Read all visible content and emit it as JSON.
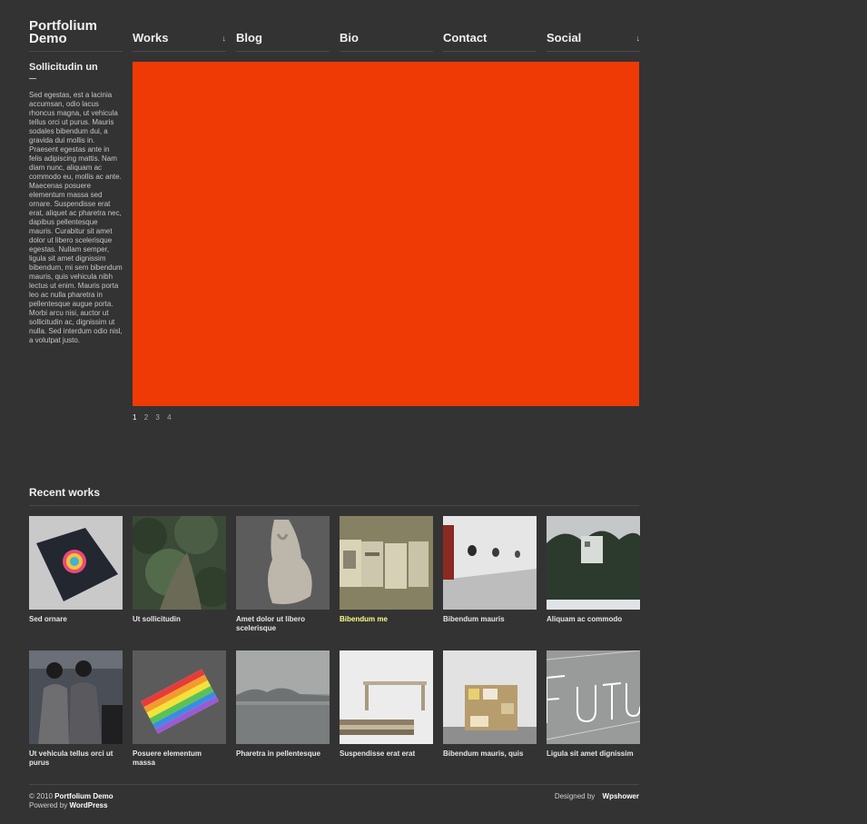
{
  "site": {
    "title": "Portfolium Demo"
  },
  "nav": [
    {
      "label": "Works",
      "has_dropdown": true
    },
    {
      "label": "Blog",
      "has_dropdown": false
    },
    {
      "label": "Bio",
      "has_dropdown": false
    },
    {
      "label": "Contact",
      "has_dropdown": false
    },
    {
      "label": "Social",
      "has_dropdown": true
    }
  ],
  "dropdown_glyph": "↓",
  "sidebar": {
    "title": "Sollicitudin un",
    "text": "Sed egestas, est a lacinia accumsan, odio lacus rhoncus magna, ut vehicula tellus orci ut purus. Mauris sodales bibendum dui, a gravida dui mollis in. Praesent egestas ante in felis adipiscing mattis. Nam diam nunc, aliquam ac commodo eu, mollis ac ante. Maecenas posuere elementum massa sed ornare. Suspendisse erat erat, aliquet ac pharetra nec, dapibus pellentesque mauris. Curabitur sit amet dolor ut libero scelerisque egestas. Nullam semper, ligula sit amet dignissim bibendum, mi sem bibendum mauris, quis vehicula nibh lectus ut enim. Mauris porta leo ac nulla pharetra in pellentesque augue porta. Morbi arcu nisi, auctor ut sollicitudin ac, dignissim ut nulla. Sed interdum odio nisl, a volutpat justo."
  },
  "hero": {
    "color": "#ef3a06"
  },
  "pager": {
    "pages": [
      "1",
      "2",
      "3",
      "4"
    ],
    "active": "1"
  },
  "recent": {
    "title": "Recent works",
    "items": [
      {
        "title": "Sed ornare",
        "image": "notebook-with-color-wheel",
        "highlight": false
      },
      {
        "title": "Ut sollicitudin",
        "image": "green-foliage",
        "highlight": false
      },
      {
        "title": "Amet dolor ut libero scelerisque",
        "image": "fabric-bag",
        "highlight": false
      },
      {
        "title": "Bibendum me",
        "image": "printed-booklets",
        "highlight": true
      },
      {
        "title": "Bibendum mauris",
        "image": "gallery-wall-holes",
        "highlight": false
      },
      {
        "title": "Aliquam ac commodo",
        "image": "house-in-forest",
        "highlight": false
      },
      {
        "title": "Ut vehicula tellus orci ut purus",
        "image": "two-figures-in-suits",
        "highlight": false
      },
      {
        "title": "Posuere elementum massa",
        "image": "rainbow-book",
        "highlight": false
      },
      {
        "title": "Pharetra in pellentesque",
        "image": "misty-sea",
        "highlight": false
      },
      {
        "title": "Suspendisse erat erat",
        "image": "wooden-pallet-bench",
        "highlight": false
      },
      {
        "title": "Bibendum mauris, quis",
        "image": "bookshelf-room",
        "highlight": false
      },
      {
        "title": "Ligula sit amet dignissim",
        "image": "futura-lettering",
        "highlight": false
      }
    ]
  },
  "footer": {
    "copyright": "© 2010",
    "site_name": "Portfolium Demo",
    "powered_by": "Powered by",
    "powered_name": "WordPress",
    "designed_by": "Designed by",
    "designer": "Wpshower"
  }
}
